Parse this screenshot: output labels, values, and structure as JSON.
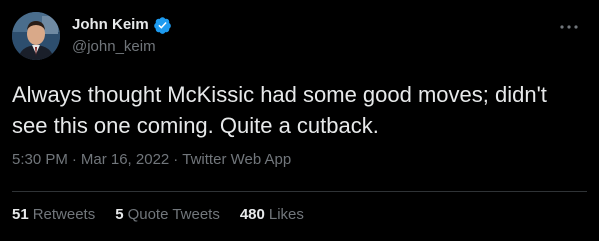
{
  "author": {
    "display_name": "John Keim",
    "handle": "@john_keim",
    "verified": true
  },
  "tweet": {
    "text": "Always thought McKissic had some good moves; didn't see this one coming. Quite a cutback.",
    "time": "5:30 PM",
    "date": "Mar 16, 2022",
    "source": "Twitter Web App",
    "separator": "·"
  },
  "stats": {
    "retweets": {
      "count": "51",
      "label": "Retweets"
    },
    "quote_tweets": {
      "count": "5",
      "label": "Quote Tweets"
    },
    "likes": {
      "count": "480",
      "label": "Likes"
    }
  },
  "colors": {
    "background": "#000000",
    "primary_text": "#e7e9ea",
    "secondary_text": "#71767b",
    "verified_badge": "#1d9bf0",
    "divider": "#2f3336"
  },
  "icons": {
    "verified": "verified-badge-icon",
    "more": "more-options-icon"
  }
}
